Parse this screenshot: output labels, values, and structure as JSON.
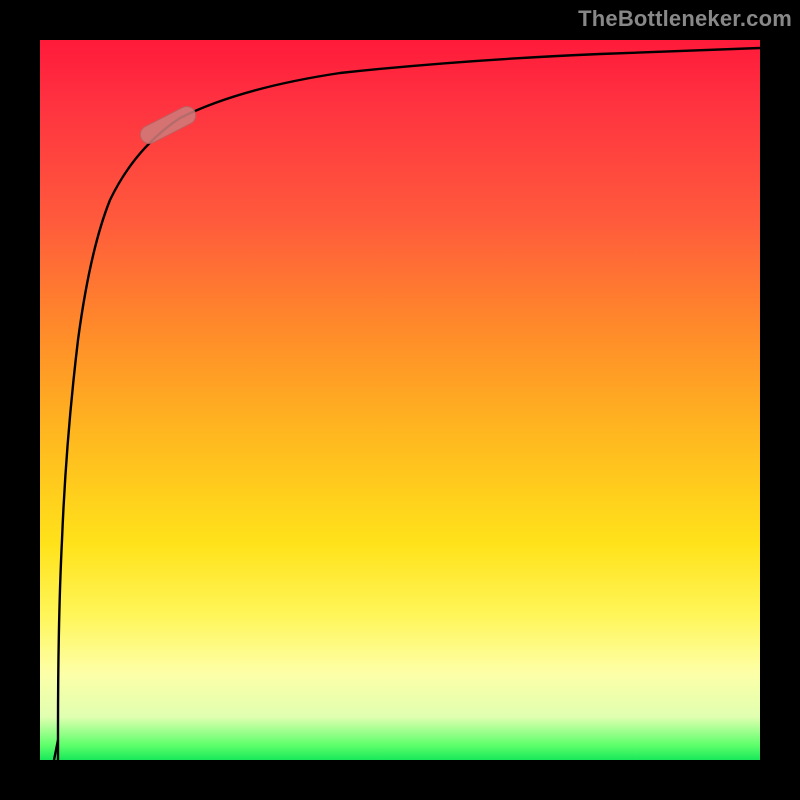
{
  "attribution": "TheBottleneker.com",
  "colors": {
    "curve": "#000000",
    "marker_fill": "#d07a7a",
    "marker_stroke": "#b05555",
    "plot_border": "#000000"
  },
  "chart_data": {
    "type": "line",
    "title": "",
    "xlabel": "",
    "ylabel": "",
    "x": [
      0,
      1,
      2,
      3,
      4,
      6,
      8,
      10,
      15,
      20,
      30,
      40,
      60,
      80,
      100
    ],
    "values": [
      0,
      5,
      30,
      55,
      70,
      80,
      85,
      88,
      91,
      92.5,
      94,
      95,
      96,
      97,
      98
    ],
    "xlim": [
      0,
      100
    ],
    "ylim": [
      0,
      100
    ],
    "marker": {
      "x": 12,
      "y": 90,
      "angle_deg": 25
    },
    "background_gradient": "red-orange-yellow-green (vertical, bottleneck heatmap)"
  }
}
